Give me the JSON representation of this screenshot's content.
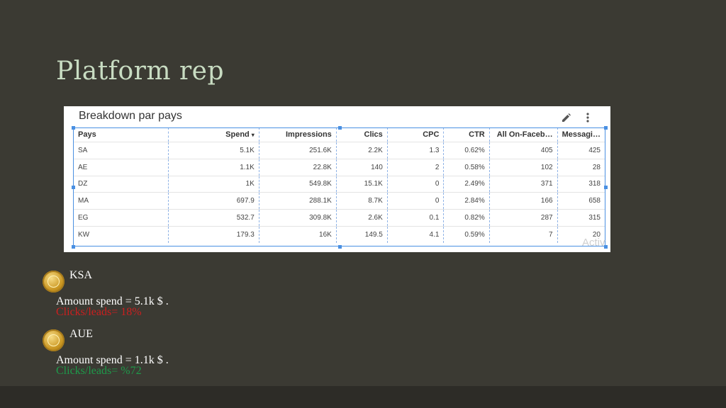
{
  "slide": {
    "title": "Platform rep"
  },
  "report": {
    "title": "Breakdown par pays",
    "watermark": "Activ",
    "columns": [
      {
        "label": "Pays"
      },
      {
        "label": "Spend",
        "sort": "▾"
      },
      {
        "label": "Impressions"
      },
      {
        "label": "Clics"
      },
      {
        "label": "CPC"
      },
      {
        "label": "CTR"
      },
      {
        "label": "All On-Faceb…"
      },
      {
        "label": "Messagi…"
      }
    ],
    "rows": [
      [
        "SA",
        "5.1K",
        "251.6K",
        "2.2K",
        "1.3",
        "0.62%",
        "405",
        "425"
      ],
      [
        "AE",
        "1.1K",
        "22.8K",
        "140",
        "2",
        "0.58%",
        "102",
        "28"
      ],
      [
        "DZ",
        "1K",
        "549.8K",
        "15.1K",
        "0",
        "2.49%",
        "371",
        "318"
      ],
      [
        "MA",
        "697.9",
        "288.1K",
        "8.7K",
        "0",
        "2.84%",
        "166",
        "658"
      ],
      [
        "EG",
        "532.7",
        "309.8K",
        "2.6K",
        "0.1",
        "0.82%",
        "287",
        "315"
      ],
      [
        "KW",
        "179.3",
        "16K",
        "149.5",
        "4.1",
        "0.59%",
        "7",
        "20"
      ]
    ]
  },
  "notes": [
    {
      "icon": "medal-icon",
      "label": "KSA",
      "amount": "Amount spend = 5.1k $ .",
      "clicks": "Clicks/leads= 18%",
      "clicks_color": "#cc1f1f"
    },
    {
      "icon": "medal-icon",
      "label": "AUE",
      "amount": "Amount spend = 1.1k $ .",
      "clicks": "Clicks/leads= %72",
      "clicks_color": "#1e9a4a"
    }
  ],
  "colors": {
    "background": "#3b3a33",
    "title": "#c8dcc2",
    "selection": "#4a90e2"
  }
}
